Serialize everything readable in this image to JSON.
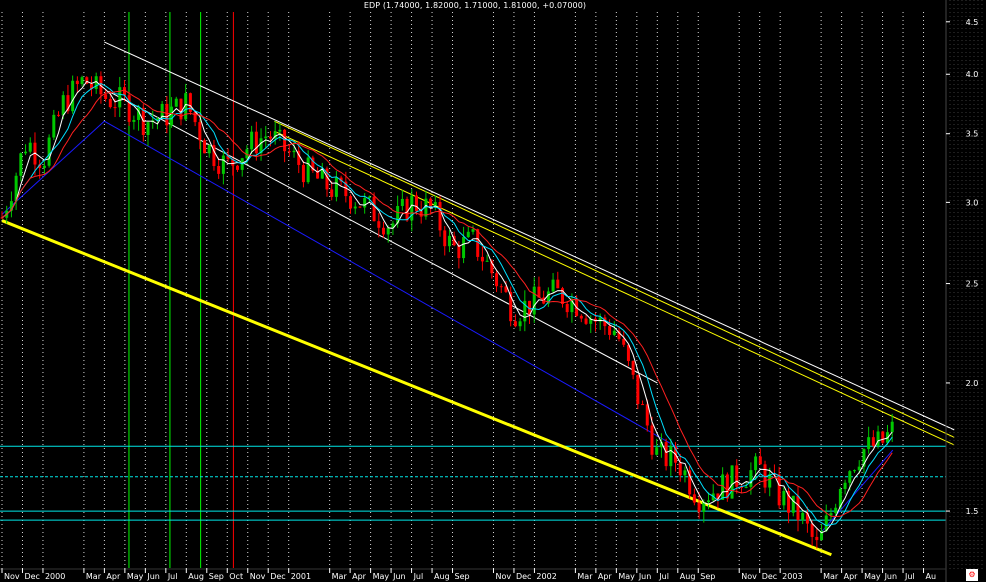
{
  "title": "EDP (1.74000, 1.82000, 1.71000, 1.81000, +0.07000)",
  "colors": {
    "background": "#000000",
    "price_up": "#00c800",
    "price_down": "#ff0000",
    "ma_fast": "#ffffff",
    "ma_mid": "#00e0ff",
    "ma_slow": "#ff2020",
    "channel_lower_yellow": "#ffff00",
    "channel_upper": "#ffffff",
    "support_blue": "#1a1aff",
    "horizontal_cyan": "#00e5e5",
    "vline_green": "#00ff00",
    "vline_red": "#ff0000"
  },
  "chart_data": {
    "type": "candlestick",
    "title": "EDP (1.74000, 1.82000, 1.71000, 1.81000, +0.07000)",
    "y_scale": "log",
    "ylim": [
      1.32,
      4.6
    ],
    "y_ticks": [
      "4.5",
      "4.0",
      "3.5",
      "3.0",
      "2.5",
      "2.0",
      "1.5"
    ],
    "y_tick_values": [
      4.5,
      4.0,
      3.5,
      3.0,
      2.5,
      2.0,
      1.5
    ],
    "x_ticks": [
      "Nov",
      "Dec",
      "2000",
      "Mar",
      "Apr",
      "May",
      "Jun",
      "Jul",
      "Aug",
      "Sep",
      "Oct",
      "Nov",
      "Dec",
      "2001",
      "Mar",
      "Apr",
      "May",
      "Jun",
      "Jul",
      "Aug",
      "Sep",
      "Nov",
      "Dec",
      "2002",
      "Mar",
      "Apr",
      "May",
      "Jun",
      "Jul",
      "Aug",
      "Sep",
      "Nov",
      "Dec",
      "2003",
      "Mar",
      "Apr",
      "May",
      "Jun",
      "Jul",
      "Au"
    ],
    "x_tick_months": [
      0,
      1,
      2,
      4,
      5,
      6,
      7,
      8,
      9,
      10,
      11,
      12,
      13,
      14,
      16,
      17,
      18,
      19,
      20,
      21,
      22,
      24,
      25,
      26,
      28,
      29,
      30,
      31,
      32,
      33,
      34,
      36,
      37,
      38,
      40,
      41,
      42,
      43,
      44,
      45
    ],
    "x_range_months": [
      0,
      46
    ],
    "price_path": [
      [
        0,
        2.9
      ],
      [
        1.2,
        3.45
      ],
      [
        2.0,
        3.3
      ],
      [
        3.0,
        3.75
      ],
      [
        4.0,
        3.95
      ],
      [
        5.0,
        3.8
      ],
      [
        6.0,
        3.75
      ],
      [
        7.0,
        3.6
      ],
      [
        8.0,
        3.65
      ],
      [
        9.0,
        3.75
      ],
      [
        10.0,
        3.4
      ],
      [
        11.0,
        3.25
      ],
      [
        12.0,
        3.4
      ],
      [
        13.0,
        3.5
      ],
      [
        14.0,
        3.35
      ],
      [
        15.0,
        3.2
      ],
      [
        16.0,
        3.1
      ],
      [
        17.0,
        3.05
      ],
      [
        18.0,
        2.95
      ],
      [
        19.0,
        2.85
      ],
      [
        20.0,
        3.0
      ],
      [
        21.0,
        2.95
      ],
      [
        22.0,
        2.7
      ],
      [
        23.0,
        2.75
      ],
      [
        24.0,
        2.55
      ],
      [
        25.0,
        2.35
      ],
      [
        26.0,
        2.4
      ],
      [
        27.0,
        2.45
      ],
      [
        28.0,
        2.4
      ],
      [
        29.0,
        2.3
      ],
      [
        30.0,
        2.25
      ],
      [
        31.0,
        1.95
      ],
      [
        32.0,
        1.7
      ],
      [
        33.0,
        1.68
      ],
      [
        34.0,
        1.55
      ],
      [
        35.0,
        1.58
      ],
      [
        36.0,
        1.62
      ],
      [
        37.0,
        1.65
      ],
      [
        38.0,
        1.55
      ],
      [
        39.0,
        1.48
      ],
      [
        39.8,
        1.38
      ],
      [
        40.5,
        1.5
      ],
      [
        41.0,
        1.62
      ],
      [
        42.0,
        1.72
      ],
      [
        43.0,
        1.75
      ],
      [
        43.6,
        1.81
      ]
    ],
    "trend_lines": [
      {
        "name": "lower-yellow",
        "points": [
          [
            0,
            2.88
          ],
          [
            40.5,
            1.36
          ]
        ]
      },
      {
        "name": "upper-white",
        "points": [
          [
            5,
            4.3
          ],
          [
            46.5,
            1.8
          ]
        ]
      },
      {
        "name": "upper-white-2",
        "points": [
          [
            5.2,
            3.85
          ],
          [
            32,
            2.0
          ]
        ]
      },
      {
        "name": "upper-yellow-1",
        "points": [
          [
            13.3,
            3.6
          ],
          [
            46.5,
            1.77
          ]
        ]
      },
      {
        "name": "upper-yellow-2",
        "points": [
          [
            13.3,
            3.52
          ],
          [
            46.5,
            1.74
          ]
        ]
      },
      {
        "name": "blue-support-1",
        "points": [
          [
            0,
            2.92
          ],
          [
            5.0,
            3.6
          ]
        ]
      },
      {
        "name": "blue-support-2",
        "points": [
          [
            5.0,
            3.6
          ],
          [
            33.0,
            1.73
          ]
        ]
      },
      {
        "name": "blue-support-3",
        "points": [
          [
            40.0,
            1.43
          ],
          [
            43.5,
            1.72
          ]
        ]
      }
    ],
    "horizontal_levels": [
      1.735,
      1.62,
      1.5,
      1.47
    ],
    "vertical_markers": [
      {
        "month": 6.2,
        "color": "green"
      },
      {
        "month": 8.2,
        "color": "green"
      },
      {
        "month": 9.7,
        "color": "green"
      },
      {
        "month": 11.3,
        "color": "red"
      }
    ]
  }
}
